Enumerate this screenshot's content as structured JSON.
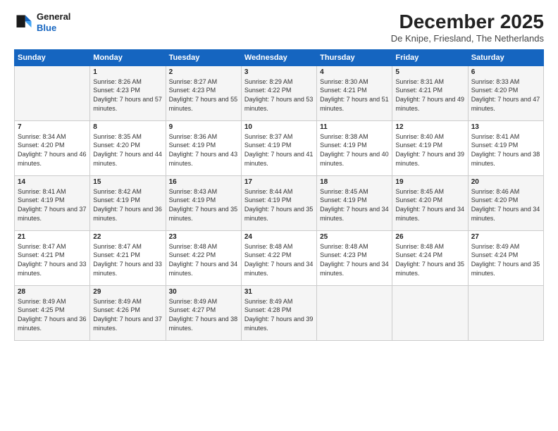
{
  "logo": {
    "line1": "General",
    "line2": "Blue"
  },
  "title": "December 2025",
  "subtitle": "De Knipe, Friesland, The Netherlands",
  "days_header": [
    "Sunday",
    "Monday",
    "Tuesday",
    "Wednesday",
    "Thursday",
    "Friday",
    "Saturday"
  ],
  "weeks": [
    [
      {
        "day": "",
        "sunrise": "",
        "sunset": "",
        "daylight": ""
      },
      {
        "day": "1",
        "sunrise": "Sunrise: 8:26 AM",
        "sunset": "Sunset: 4:23 PM",
        "daylight": "Daylight: 7 hours and 57 minutes."
      },
      {
        "day": "2",
        "sunrise": "Sunrise: 8:27 AM",
        "sunset": "Sunset: 4:23 PM",
        "daylight": "Daylight: 7 hours and 55 minutes."
      },
      {
        "day": "3",
        "sunrise": "Sunrise: 8:29 AM",
        "sunset": "Sunset: 4:22 PM",
        "daylight": "Daylight: 7 hours and 53 minutes."
      },
      {
        "day": "4",
        "sunrise": "Sunrise: 8:30 AM",
        "sunset": "Sunset: 4:21 PM",
        "daylight": "Daylight: 7 hours and 51 minutes."
      },
      {
        "day": "5",
        "sunrise": "Sunrise: 8:31 AM",
        "sunset": "Sunset: 4:21 PM",
        "daylight": "Daylight: 7 hours and 49 minutes."
      },
      {
        "day": "6",
        "sunrise": "Sunrise: 8:33 AM",
        "sunset": "Sunset: 4:20 PM",
        "daylight": "Daylight: 7 hours and 47 minutes."
      }
    ],
    [
      {
        "day": "7",
        "sunrise": "Sunrise: 8:34 AM",
        "sunset": "Sunset: 4:20 PM",
        "daylight": "Daylight: 7 hours and 46 minutes."
      },
      {
        "day": "8",
        "sunrise": "Sunrise: 8:35 AM",
        "sunset": "Sunset: 4:20 PM",
        "daylight": "Daylight: 7 hours and 44 minutes."
      },
      {
        "day": "9",
        "sunrise": "Sunrise: 8:36 AM",
        "sunset": "Sunset: 4:19 PM",
        "daylight": "Daylight: 7 hours and 43 minutes."
      },
      {
        "day": "10",
        "sunrise": "Sunrise: 8:37 AM",
        "sunset": "Sunset: 4:19 PM",
        "daylight": "Daylight: 7 hours and 41 minutes."
      },
      {
        "day": "11",
        "sunrise": "Sunrise: 8:38 AM",
        "sunset": "Sunset: 4:19 PM",
        "daylight": "Daylight: 7 hours and 40 minutes."
      },
      {
        "day": "12",
        "sunrise": "Sunrise: 8:40 AM",
        "sunset": "Sunset: 4:19 PM",
        "daylight": "Daylight: 7 hours and 39 minutes."
      },
      {
        "day": "13",
        "sunrise": "Sunrise: 8:41 AM",
        "sunset": "Sunset: 4:19 PM",
        "daylight": "Daylight: 7 hours and 38 minutes."
      }
    ],
    [
      {
        "day": "14",
        "sunrise": "Sunrise: 8:41 AM",
        "sunset": "Sunset: 4:19 PM",
        "daylight": "Daylight: 7 hours and 37 minutes."
      },
      {
        "day": "15",
        "sunrise": "Sunrise: 8:42 AM",
        "sunset": "Sunset: 4:19 PM",
        "daylight": "Daylight: 7 hours and 36 minutes."
      },
      {
        "day": "16",
        "sunrise": "Sunrise: 8:43 AM",
        "sunset": "Sunset: 4:19 PM",
        "daylight": "Daylight: 7 hours and 35 minutes."
      },
      {
        "day": "17",
        "sunrise": "Sunrise: 8:44 AM",
        "sunset": "Sunset: 4:19 PM",
        "daylight": "Daylight: 7 hours and 35 minutes."
      },
      {
        "day": "18",
        "sunrise": "Sunrise: 8:45 AM",
        "sunset": "Sunset: 4:19 PM",
        "daylight": "Daylight: 7 hours and 34 minutes."
      },
      {
        "day": "19",
        "sunrise": "Sunrise: 8:45 AM",
        "sunset": "Sunset: 4:20 PM",
        "daylight": "Daylight: 7 hours and 34 minutes."
      },
      {
        "day": "20",
        "sunrise": "Sunrise: 8:46 AM",
        "sunset": "Sunset: 4:20 PM",
        "daylight": "Daylight: 7 hours and 34 minutes."
      }
    ],
    [
      {
        "day": "21",
        "sunrise": "Sunrise: 8:47 AM",
        "sunset": "Sunset: 4:21 PM",
        "daylight": "Daylight: 7 hours and 33 minutes."
      },
      {
        "day": "22",
        "sunrise": "Sunrise: 8:47 AM",
        "sunset": "Sunset: 4:21 PM",
        "daylight": "Daylight: 7 hours and 33 minutes."
      },
      {
        "day": "23",
        "sunrise": "Sunrise: 8:48 AM",
        "sunset": "Sunset: 4:22 PM",
        "daylight": "Daylight: 7 hours and 34 minutes."
      },
      {
        "day": "24",
        "sunrise": "Sunrise: 8:48 AM",
        "sunset": "Sunset: 4:22 PM",
        "daylight": "Daylight: 7 hours and 34 minutes."
      },
      {
        "day": "25",
        "sunrise": "Sunrise: 8:48 AM",
        "sunset": "Sunset: 4:23 PM",
        "daylight": "Daylight: 7 hours and 34 minutes."
      },
      {
        "day": "26",
        "sunrise": "Sunrise: 8:48 AM",
        "sunset": "Sunset: 4:24 PM",
        "daylight": "Daylight: 7 hours and 35 minutes."
      },
      {
        "day": "27",
        "sunrise": "Sunrise: 8:49 AM",
        "sunset": "Sunset: 4:24 PM",
        "daylight": "Daylight: 7 hours and 35 minutes."
      }
    ],
    [
      {
        "day": "28",
        "sunrise": "Sunrise: 8:49 AM",
        "sunset": "Sunset: 4:25 PM",
        "daylight": "Daylight: 7 hours and 36 minutes."
      },
      {
        "day": "29",
        "sunrise": "Sunrise: 8:49 AM",
        "sunset": "Sunset: 4:26 PM",
        "daylight": "Daylight: 7 hours and 37 minutes."
      },
      {
        "day": "30",
        "sunrise": "Sunrise: 8:49 AM",
        "sunset": "Sunset: 4:27 PM",
        "daylight": "Daylight: 7 hours and 38 minutes."
      },
      {
        "day": "31",
        "sunrise": "Sunrise: 8:49 AM",
        "sunset": "Sunset: 4:28 PM",
        "daylight": "Daylight: 7 hours and 39 minutes."
      },
      {
        "day": "",
        "sunrise": "",
        "sunset": "",
        "daylight": ""
      },
      {
        "day": "",
        "sunrise": "",
        "sunset": "",
        "daylight": ""
      },
      {
        "day": "",
        "sunrise": "",
        "sunset": "",
        "daylight": ""
      }
    ]
  ]
}
